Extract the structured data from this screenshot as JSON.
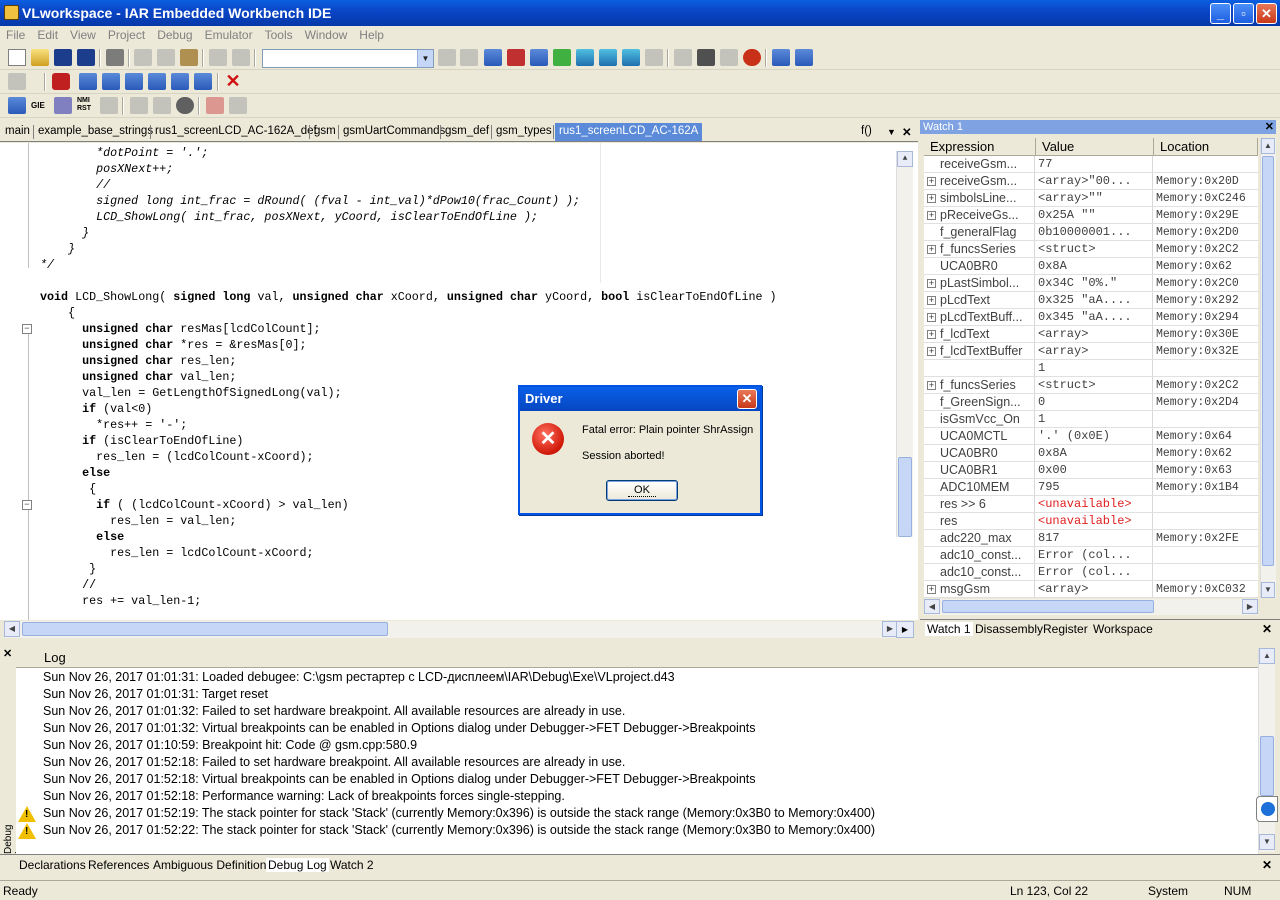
{
  "window": {
    "title": "VLworkspace - IAR Embedded Workbench IDE"
  },
  "menu": [
    "File",
    "Edit",
    "View",
    "Project",
    "Debug",
    "Emulator",
    "Tools",
    "Window",
    "Help"
  ],
  "editor_tabs": [
    "main",
    "example_base_strings",
    "rus1_screenLCD_AC-162A_def",
    "gsm",
    "gsmUartCommands",
    "gsm_def",
    "gsm_types",
    "rus1_screenLCD_AC-162A"
  ],
  "editor_func_label": "f()",
  "code_lines": [
    {
      "t": "        *dotPoint = '.';",
      "c": "cm"
    },
    {
      "t": "        posXNext++;",
      "c": "cm"
    },
    {
      "t": "        //",
      "c": "cm"
    },
    {
      "t": "        signed long int_frac = dRound( (fval - int_val)*dPow10(frac_Count) );",
      "c": "cm"
    },
    {
      "t": "        LCD_ShowLong( int_frac, posXNext, yCoord, isClearToEndOfLine );",
      "c": "cm"
    },
    {
      "t": "      }",
      "c": "cm"
    },
    {
      "t": "    }",
      "c": "cm"
    },
    {
      "t": "*/",
      "c": "cm"
    },
    {
      "t": "",
      "c": ""
    },
    {
      "t": "void LCD_ShowLong( signed long val, unsigned char xCoord, unsigned char yCoord, bool isClearToEndOfLine )",
      "c": ""
    },
    {
      "t": "    {",
      "c": ""
    },
    {
      "t": "      unsigned char resMas[lcdColCount];",
      "c": ""
    },
    {
      "t": "      unsigned char *res = &resMas[0];",
      "c": ""
    },
    {
      "t": "      unsigned char res_len;",
      "c": ""
    },
    {
      "t": "      unsigned char val_len;",
      "c": ""
    },
    {
      "t": "      val_len = GetLengthOfSignedLong(val);",
      "c": ""
    },
    {
      "t": "      if (val<0)",
      "c": ""
    },
    {
      "t": "        *res++ = '-';",
      "c": ""
    },
    {
      "t": "      if (isClearToEndOfLine)",
      "c": ""
    },
    {
      "t": "        res_len = (lcdColCount-xCoord);",
      "c": ""
    },
    {
      "t": "      else",
      "c": ""
    },
    {
      "t": "       {",
      "c": ""
    },
    {
      "t": "        if ( (lcdColCount-xCoord) > val_len)",
      "c": ""
    },
    {
      "t": "          res_len = val_len;",
      "c": ""
    },
    {
      "t": "        else",
      "c": ""
    },
    {
      "t": "          res_len = lcdColCount-xCoord;",
      "c": ""
    },
    {
      "t": "       }",
      "c": ""
    },
    {
      "t": "      //",
      "c": ""
    },
    {
      "t": "      res += val_len-1;",
      "c": ""
    }
  ],
  "watch": {
    "title": "Watch 1",
    "headers": [
      "Expression",
      "Value",
      "Location"
    ],
    "rows": [
      {
        "e": "receiveGsm...",
        "v": "77",
        "l": "",
        "p": false
      },
      {
        "e": "receiveGsm...",
        "v": "<array>\"00...",
        "l": "Memory:0x20D",
        "p": true
      },
      {
        "e": "simbolsLine...",
        "v": "<array>\"\"",
        "l": "Memory:0xC246",
        "p": true
      },
      {
        "e": "pReceiveGs...",
        "v": "0x25A \"\"",
        "l": "Memory:0x29E",
        "p": true
      },
      {
        "e": "f_generalFlag",
        "v": "0b10000001...",
        "l": "Memory:0x2D0",
        "p": false
      },
      {
        "e": "f_funcsSeries",
        "v": "<struct>",
        "l": "Memory:0x2C2",
        "p": true
      },
      {
        "e": "UCA0BR0",
        "v": "0x8A",
        "l": "Memory:0x62",
        "p": false
      },
      {
        "e": "pLastSimbol...",
        "v": "0x34C \"0%.\"",
        "l": "Memory:0x2C0",
        "p": true
      },
      {
        "e": "pLcdText",
        "v": "0x325 \"aA....",
        "l": "Memory:0x292",
        "p": true
      },
      {
        "e": "pLcdTextBuff...",
        "v": "0x345 \"aA....",
        "l": "Memory:0x294",
        "p": true
      },
      {
        "e": "f_lcdText",
        "v": "<array>",
        "l": "Memory:0x30E",
        "p": true
      },
      {
        "e": "f_lcdTextBuffer",
        "v": "<array>",
        "l": "Memory:0x32E",
        "p": true
      },
      {
        "e": "",
        "v": "1",
        "l": "",
        "p": false
      },
      {
        "e": "f_funcsSeries",
        "v": "<struct>",
        "l": "Memory:0x2C2",
        "p": true
      },
      {
        "e": "f_GreenSign...",
        "v": "0",
        "l": "Memory:0x2D4",
        "p": false
      },
      {
        "e": "isGsmVcc_On",
        "v": "1",
        "l": "",
        "p": false
      },
      {
        "e": "UCA0MCTL",
        "v": "'.' (0x0E)",
        "l": "Memory:0x64",
        "p": false
      },
      {
        "e": "UCA0BR0",
        "v": "0x8A",
        "l": "Memory:0x62",
        "p": false
      },
      {
        "e": "UCA0BR1",
        "v": "0x00",
        "l": "Memory:0x63",
        "p": false
      },
      {
        "e": "ADC10MEM",
        "v": "795",
        "l": "Memory:0x1B4",
        "p": false
      },
      {
        "e": "res >> 6",
        "v": "<unavailable>",
        "l": "",
        "p": false,
        "red": true
      },
      {
        "e": "res",
        "v": "<unavailable>",
        "l": "",
        "p": false,
        "red": true
      },
      {
        "e": "adc220_max",
        "v": "817",
        "l": "Memory:0x2FE",
        "p": false
      },
      {
        "e": "adc10_const...",
        "v": "Error (col...",
        "l": "",
        "p": false
      },
      {
        "e": "adc10_const...",
        "v": "Error (col...",
        "l": "",
        "p": false
      },
      {
        "e": "msgGsm",
        "v": "<array>",
        "l": "Memory:0xC032",
        "p": true
      }
    ],
    "tabs": [
      "Watch 1",
      "Disassembly",
      "Register",
      "Workspace"
    ]
  },
  "log": {
    "header": "Log",
    "side_label": "Debug Log",
    "lines": [
      {
        "t": "Sun Nov 26, 2017 01:01:31: Loaded debugee: C:\\gsm рестартер с LCD-дисплеем\\IAR\\Debug\\Exe\\VLproject.d43",
        "w": false
      },
      {
        "t": "Sun Nov 26, 2017 01:01:31: Target reset",
        "w": false
      },
      {
        "t": "Sun Nov 26, 2017 01:01:32: Failed to set hardware breakpoint. All available resources are already in use.",
        "w": false
      },
      {
        "t": "Sun Nov 26, 2017 01:01:32: Virtual breakpoints can be enabled in Options dialog under Debugger->FET Debugger->Breakpoints",
        "w": false
      },
      {
        "t": "Sun Nov 26, 2017 01:10:59: Breakpoint hit: Code @ gsm.cpp:580.9",
        "w": false
      },
      {
        "t": "Sun Nov 26, 2017 01:52:18: Failed to set hardware breakpoint. All available resources are already in use.",
        "w": false
      },
      {
        "t": "Sun Nov 26, 2017 01:52:18: Virtual breakpoints can be enabled in Options dialog under Debugger->FET Debugger->Breakpoints",
        "w": false
      },
      {
        "t": "Sun Nov 26, 2017 01:52:18: Performance warning: Lack of breakpoints forces single-stepping.",
        "w": false
      },
      {
        "t": "Sun Nov 26, 2017 01:52:19: The stack pointer for stack 'Stack' (currently Memory:0x396) is outside the stack range (Memory:0x3B0 to Memory:0x400)",
        "w": true
      },
      {
        "t": "Sun Nov 26, 2017 01:52:22: The stack pointer for stack 'Stack' (currently Memory:0x396) is outside the stack range (Memory:0x3B0 to Memory:0x400)",
        "w": true
      }
    ]
  },
  "bottom_tabs": [
    "Declarations",
    "References",
    "Ambiguous Definitions",
    "Debug Log",
    "Watch 2"
  ],
  "status": {
    "left": "Ready",
    "pos": "Ln 123, Col 22",
    "mode": "System",
    "num": "NUM"
  },
  "dialog": {
    "title": "Driver",
    "close": "✕",
    "line1": "Fatal error: Plain pointer ShrAssign",
    "line2": "Session aborted!",
    "ok": "OK"
  },
  "colors": {
    "titlebar": "#0a46c8",
    "dialog_border": "#0054e3",
    "warning": "#f0c000",
    "error": "#d01808"
  }
}
